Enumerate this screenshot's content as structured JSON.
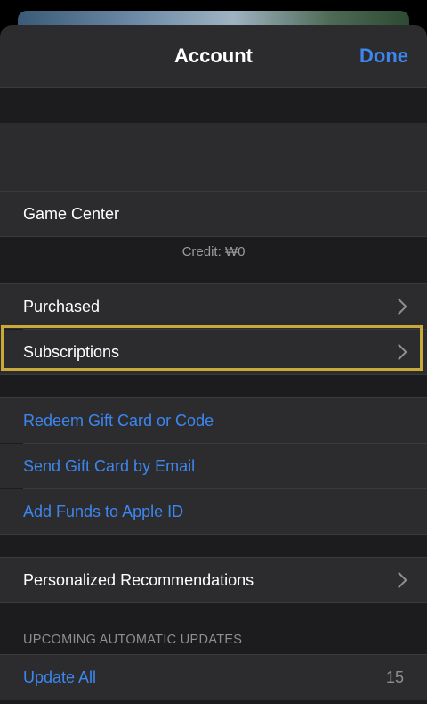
{
  "sheet": {
    "title": "Account",
    "done_label": "Done"
  },
  "profile_block": {
    "game_center_label": "Game Center",
    "credit_text": "Credit: ₩0"
  },
  "purchases": {
    "purchased_label": "Purchased",
    "subscriptions_label": "Subscriptions"
  },
  "gift_links": {
    "redeem_label": "Redeem Gift Card or Code",
    "send_gift_label": "Send Gift Card by Email",
    "add_funds_label": "Add Funds to Apple ID"
  },
  "recommendations": {
    "personalized_label": "Personalized Recommendations"
  },
  "updates": {
    "section_header": "UPCOMING AUTOMATIC UPDATES",
    "update_all_label": "Update All",
    "update_count": "15"
  },
  "colors": {
    "accent": "#3d86f0",
    "highlight": "#c9a93a",
    "sheet_bg": "#1c1c1e",
    "row_bg": "#2c2c2e"
  },
  "icons": [
    "chevron-right-icon"
  ]
}
